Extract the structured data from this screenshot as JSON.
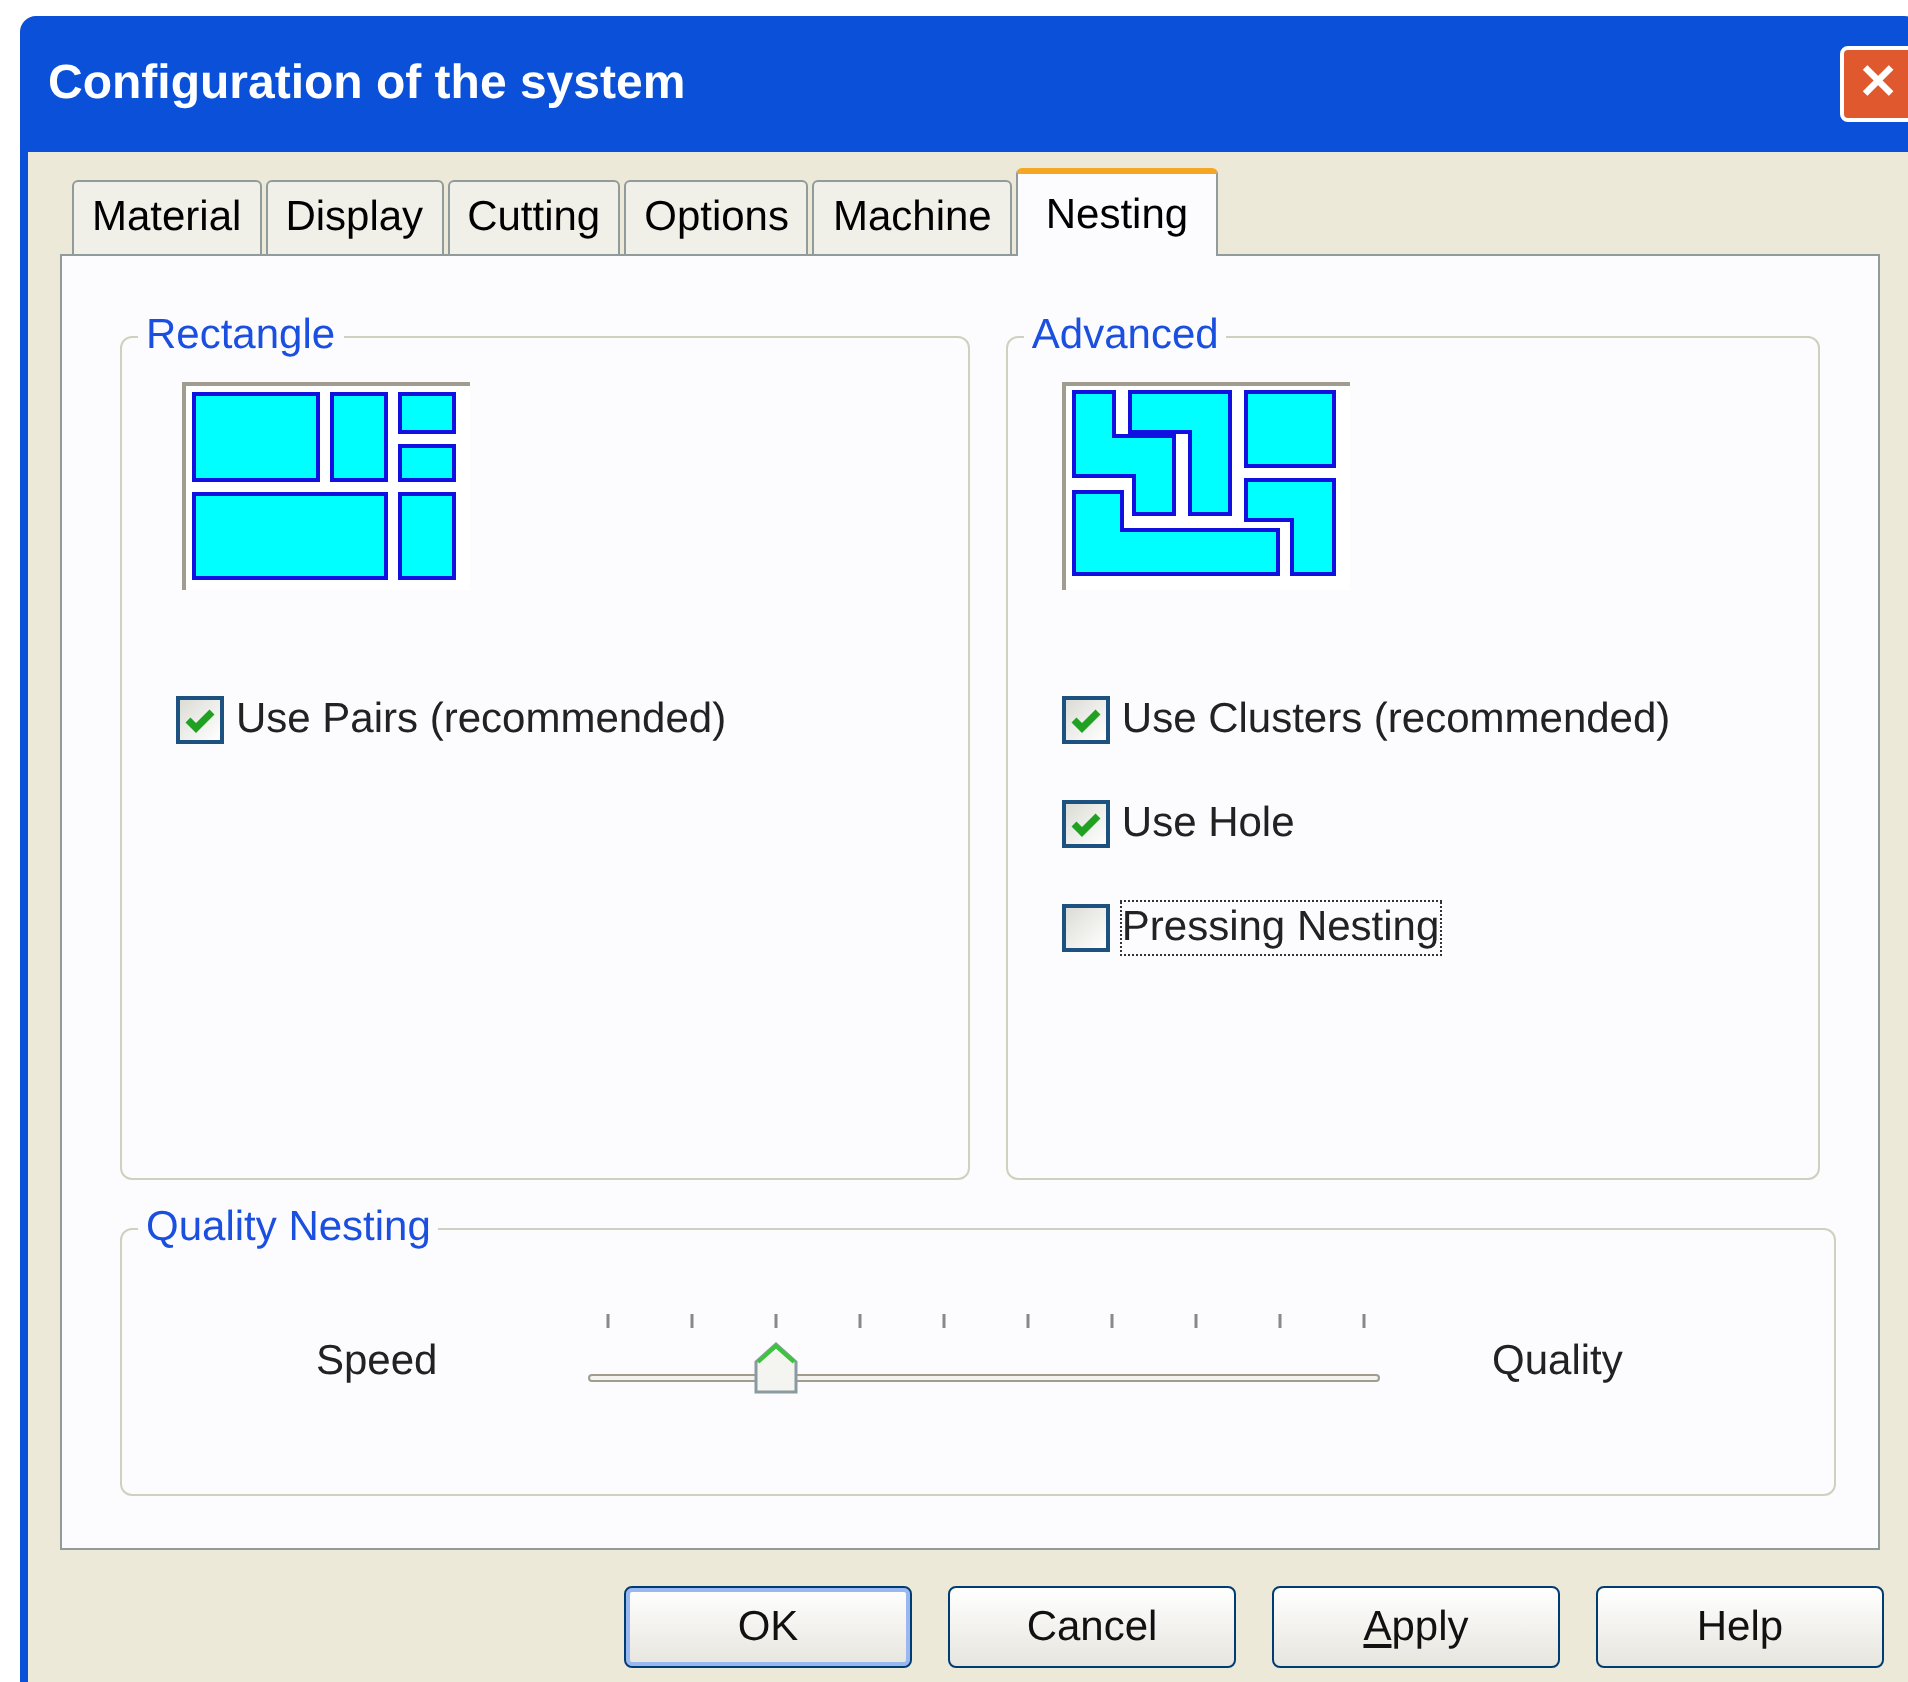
{
  "window": {
    "title": "Configuration of the system",
    "close_glyph": "✕"
  },
  "tabs": [
    {
      "label": "Material",
      "selected": false
    },
    {
      "label": "Display",
      "selected": false
    },
    {
      "label": "Cutting",
      "selected": false
    },
    {
      "label": "Options",
      "selected": false
    },
    {
      "label": "Machine",
      "selected": false
    },
    {
      "label": "Nesting",
      "selected": true
    }
  ],
  "groups": [
    {
      "title": "Rectangle",
      "kind": "rectangle",
      "checkboxes": [
        {
          "label": "Use Pairs (recommended)",
          "checked": true,
          "focused": false
        }
      ]
    },
    {
      "title": "Advanced",
      "kind": "advanced",
      "checkboxes": [
        {
          "label": "Use Clusters (recommended)",
          "checked": true,
          "focused": false
        },
        {
          "label": "Use Hole",
          "checked": true,
          "focused": false
        },
        {
          "label": "Pressing Nesting",
          "checked": false,
          "focused": true
        }
      ]
    }
  ],
  "quality": {
    "title": "Quality Nesting",
    "left_label": "Speed",
    "right_label": "Quality",
    "level": 0.222
  },
  "buttons": [
    {
      "label": "OK",
      "default": true,
      "mnemonic": false
    },
    {
      "label": "Cancel",
      "default": false,
      "mnemonic": false
    },
    {
      "label": "Apply",
      "default": false,
      "mnemonic": true
    },
    {
      "label": "Help",
      "default": false,
      "mnemonic": false
    }
  ]
}
